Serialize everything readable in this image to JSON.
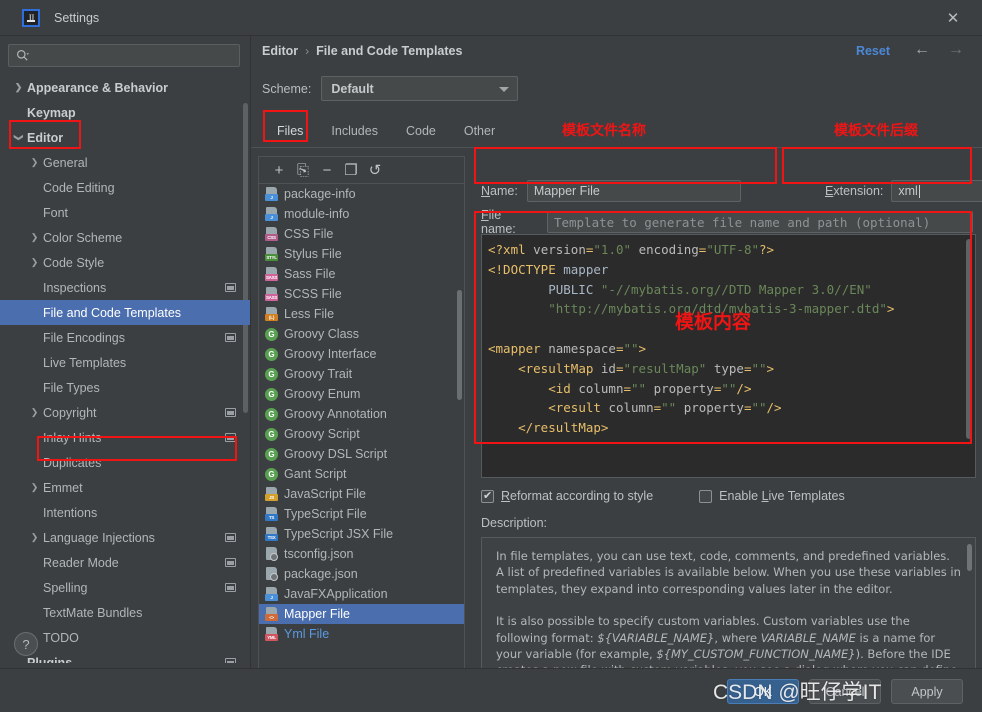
{
  "window": {
    "title": "Settings",
    "logo_icon": "intellij-idea-logo",
    "close_icon": "close-icon"
  },
  "search": {
    "placeholder": "",
    "value": "",
    "icon": "search-icon"
  },
  "sidebar": {
    "items": [
      {
        "label": "Appearance & Behavior",
        "arrow": "right",
        "bold": true,
        "indent": 0,
        "badge": false,
        "selected": false
      },
      {
        "label": "Keymap",
        "arrow": "none",
        "bold": true,
        "indent": 0,
        "badge": false,
        "selected": false
      },
      {
        "label": "Editor",
        "arrow": "down",
        "bold": true,
        "indent": 0,
        "badge": false,
        "selected": false
      },
      {
        "label": "General",
        "arrow": "right",
        "bold": false,
        "indent": 1,
        "badge": false,
        "selected": false
      },
      {
        "label": "Code Editing",
        "arrow": "none",
        "bold": false,
        "indent": 1,
        "badge": false,
        "selected": false
      },
      {
        "label": "Font",
        "arrow": "none",
        "bold": false,
        "indent": 1,
        "badge": false,
        "selected": false
      },
      {
        "label": "Color Scheme",
        "arrow": "right",
        "bold": false,
        "indent": 1,
        "badge": false,
        "selected": false
      },
      {
        "label": "Code Style",
        "arrow": "right",
        "bold": false,
        "indent": 1,
        "badge": false,
        "selected": false
      },
      {
        "label": "Inspections",
        "arrow": "none",
        "bold": false,
        "indent": 1,
        "badge": true,
        "selected": false
      },
      {
        "label": "File and Code Templates",
        "arrow": "none",
        "bold": false,
        "indent": 1,
        "badge": false,
        "selected": true
      },
      {
        "label": "File Encodings",
        "arrow": "none",
        "bold": false,
        "indent": 1,
        "badge": true,
        "selected": false
      },
      {
        "label": "Live Templates",
        "arrow": "none",
        "bold": false,
        "indent": 1,
        "badge": false,
        "selected": false
      },
      {
        "label": "File Types",
        "arrow": "none",
        "bold": false,
        "indent": 1,
        "badge": false,
        "selected": false
      },
      {
        "label": "Copyright",
        "arrow": "right",
        "bold": false,
        "indent": 1,
        "badge": true,
        "selected": false
      },
      {
        "label": "Inlay Hints",
        "arrow": "none",
        "bold": false,
        "indent": 1,
        "badge": true,
        "selected": false
      },
      {
        "label": "Duplicates",
        "arrow": "none",
        "bold": false,
        "indent": 1,
        "badge": false,
        "selected": false
      },
      {
        "label": "Emmet",
        "arrow": "right",
        "bold": false,
        "indent": 1,
        "badge": false,
        "selected": false
      },
      {
        "label": "Intentions",
        "arrow": "none",
        "bold": false,
        "indent": 1,
        "badge": false,
        "selected": false
      },
      {
        "label": "Language Injections",
        "arrow": "right",
        "bold": false,
        "indent": 1,
        "badge": true,
        "selected": false
      },
      {
        "label": "Reader Mode",
        "arrow": "none",
        "bold": false,
        "indent": 1,
        "badge": true,
        "selected": false
      },
      {
        "label": "Spelling",
        "arrow": "none",
        "bold": false,
        "indent": 1,
        "badge": true,
        "selected": false
      },
      {
        "label": "TextMate Bundles",
        "arrow": "none",
        "bold": false,
        "indent": 1,
        "badge": false,
        "selected": false
      },
      {
        "label": "TODO",
        "arrow": "none",
        "bold": false,
        "indent": 1,
        "badge": false,
        "selected": false
      },
      {
        "label": "Plugins",
        "arrow": "none",
        "bold": true,
        "indent": 0,
        "badge": true,
        "selected": false
      }
    ],
    "help_button": "?"
  },
  "header": {
    "breadcrumb_root": "Editor",
    "breadcrumb_sep": "›",
    "breadcrumb_leaf": "File and Code Templates",
    "reset_label": "Reset",
    "back_icon": "arrow-left-icon",
    "forward_icon": "arrow-right-icon"
  },
  "scheme": {
    "label": "Scheme:",
    "value": "Default",
    "caret_icon": "chevron-down-icon"
  },
  "tabs": [
    {
      "label": "Files",
      "active": true
    },
    {
      "label": "Includes",
      "active": false
    },
    {
      "label": "Code",
      "active": false
    },
    {
      "label": "Other",
      "active": false
    }
  ],
  "list_toolbar": [
    {
      "icon": "plus-icon",
      "glyph": "+"
    },
    {
      "icon": "copy-file-icon",
      "glyph": "⎘"
    },
    {
      "icon": "minus-icon",
      "glyph": "−"
    },
    {
      "icon": "duplicate-icon",
      "glyph": "❐"
    },
    {
      "icon": "reset-icon",
      "glyph": "↺"
    }
  ],
  "file_list": [
    {
      "label": "package-info",
      "icon": "java-file-icon",
      "kind": "file",
      "tag": "J",
      "tagcolor": "#4a90d9",
      "selected": false,
      "custom": false
    },
    {
      "label": "module-info",
      "icon": "java-file-icon",
      "kind": "file",
      "tag": "J",
      "tagcolor": "#4a90d9",
      "selected": false,
      "custom": false
    },
    {
      "label": "CSS File",
      "icon": "css-file-icon",
      "kind": "file",
      "tag": "CSS",
      "tagcolor": "#b05b8a",
      "selected": false,
      "custom": false
    },
    {
      "label": "Stylus File",
      "icon": "stylus-file-icon",
      "kind": "file",
      "tag": "STYL",
      "tagcolor": "#4b8f3d",
      "selected": false,
      "custom": false
    },
    {
      "label": "Sass File",
      "icon": "sass-file-icon",
      "kind": "file",
      "tag": "SASS",
      "tagcolor": "#cf649a",
      "selected": false,
      "custom": false
    },
    {
      "label": "SCSS File",
      "icon": "scss-file-icon",
      "kind": "file",
      "tag": "SASS",
      "tagcolor": "#cf649a",
      "selected": false,
      "custom": false
    },
    {
      "label": "Less File",
      "icon": "less-file-icon",
      "kind": "file",
      "tag": "{L}",
      "tagcolor": "#d08020",
      "selected": false,
      "custom": false
    },
    {
      "label": "Groovy Class",
      "icon": "groovy-class-icon",
      "kind": "groovy",
      "tag": "G",
      "tagcolor": "#5aa052",
      "selected": false,
      "custom": false
    },
    {
      "label": "Groovy Interface",
      "icon": "groovy-interface-icon",
      "kind": "groovy",
      "tag": "G",
      "tagcolor": "#5aa052",
      "selected": false,
      "custom": false
    },
    {
      "label": "Groovy Trait",
      "icon": "groovy-trait-icon",
      "kind": "groovy",
      "tag": "G",
      "tagcolor": "#5aa052",
      "selected": false,
      "custom": false
    },
    {
      "label": "Groovy Enum",
      "icon": "groovy-enum-icon",
      "kind": "groovy",
      "tag": "G",
      "tagcolor": "#5aa052",
      "selected": false,
      "custom": false
    },
    {
      "label": "Groovy Annotation",
      "icon": "groovy-annotation-icon",
      "kind": "groovy",
      "tag": "G",
      "tagcolor": "#5aa052",
      "selected": false,
      "custom": false
    },
    {
      "label": "Groovy Script",
      "icon": "groovy-script-icon",
      "kind": "groovy",
      "tag": "G",
      "tagcolor": "#5aa052",
      "selected": false,
      "custom": false
    },
    {
      "label": "Groovy DSL Script",
      "icon": "groovy-dsl-icon",
      "kind": "groovy",
      "tag": "G",
      "tagcolor": "#5aa052",
      "selected": false,
      "custom": false
    },
    {
      "label": "Gant Script",
      "icon": "gant-script-icon",
      "kind": "groovy",
      "tag": "G",
      "tagcolor": "#5aa052",
      "selected": false,
      "custom": false
    },
    {
      "label": "JavaScript File",
      "icon": "javascript-file-icon",
      "kind": "file",
      "tag": "JS",
      "tagcolor": "#d3a02c",
      "selected": false,
      "custom": false
    },
    {
      "label": "TypeScript File",
      "icon": "typescript-file-icon",
      "kind": "file",
      "tag": "TS",
      "tagcolor": "#3178c6",
      "selected": false,
      "custom": false
    },
    {
      "label": "TypeScript JSX File",
      "icon": "typescript-jsx-icon",
      "kind": "file",
      "tag": "TSX",
      "tagcolor": "#3178c6",
      "selected": false,
      "custom": false
    },
    {
      "label": "tsconfig.json",
      "icon": "json-file-icon",
      "kind": "json",
      "tag": "",
      "tagcolor": "#8a8f93",
      "selected": false,
      "custom": false
    },
    {
      "label": "package.json",
      "icon": "json-file-icon",
      "kind": "json",
      "tag": "",
      "tagcolor": "#8a8f93",
      "selected": false,
      "custom": false
    },
    {
      "label": "JavaFXApplication",
      "icon": "java-file-icon",
      "kind": "file",
      "tag": "J",
      "tagcolor": "#4a90d9",
      "selected": false,
      "custom": false
    },
    {
      "label": "Mapper File",
      "icon": "xml-file-icon",
      "kind": "file",
      "tag": "<>",
      "tagcolor": "#cf6a3a",
      "selected": true,
      "custom": true
    },
    {
      "label": "Yml File",
      "icon": "yml-file-icon",
      "kind": "file",
      "tag": "YML",
      "tagcolor": "#cf5560",
      "selected": false,
      "custom": true
    }
  ],
  "form": {
    "name_label": "Name:",
    "name_label_mnemonic": "N",
    "name_value": "Mapper File",
    "extension_label": "Extension:",
    "extension_label_mnemonic": "E",
    "extension_value": "xml",
    "filename_label": "File name:",
    "filename_label_mnemonic": "F",
    "filename_value": "",
    "filename_placeholder": "Template to generate file name and path (optional)"
  },
  "code": {
    "lines": [
      [
        {
          "t": "tag",
          "s": "<?xml"
        },
        {
          "t": "plain",
          "s": " "
        },
        {
          "t": "attr",
          "s": "version"
        },
        {
          "t": "tag",
          "s": "="
        },
        {
          "t": "str",
          "s": "\"1.0\""
        },
        {
          "t": "plain",
          "s": " "
        },
        {
          "t": "attr",
          "s": "encoding"
        },
        {
          "t": "tag",
          "s": "="
        },
        {
          "t": "str",
          "s": "\"UTF-8\""
        },
        {
          "t": "tag",
          "s": "?>"
        }
      ],
      [
        {
          "t": "tag",
          "s": "<!DOCTYPE"
        },
        {
          "t": "plain",
          "s": " mapper"
        }
      ],
      [
        {
          "t": "plain",
          "s": "        PUBLIC "
        },
        {
          "t": "str",
          "s": "\"-//mybatis.org//DTD Mapper 3.0//EN\""
        }
      ],
      [
        {
          "t": "plain",
          "s": "        "
        },
        {
          "t": "str",
          "s": "\"http://mybatis.org/dtd/mybatis-3-mapper.dtd\""
        },
        {
          "t": "tag",
          "s": ">"
        }
      ],
      [
        {
          "t": "plain",
          "s": ""
        }
      ],
      [
        {
          "t": "tag",
          "s": "<mapper"
        },
        {
          "t": "plain",
          "s": " "
        },
        {
          "t": "attr",
          "s": "namespace"
        },
        {
          "t": "tag",
          "s": "="
        },
        {
          "t": "str",
          "s": "\"\""
        },
        {
          "t": "tag",
          "s": ">"
        }
      ],
      [
        {
          "t": "plain",
          "s": "    "
        },
        {
          "t": "tag",
          "s": "<resultMap"
        },
        {
          "t": "plain",
          "s": " "
        },
        {
          "t": "attr",
          "s": "id"
        },
        {
          "t": "tag",
          "s": "="
        },
        {
          "t": "str",
          "s": "\"resultMap\""
        },
        {
          "t": "plain",
          "s": " "
        },
        {
          "t": "attr",
          "s": "type"
        },
        {
          "t": "tag",
          "s": "="
        },
        {
          "t": "str",
          "s": "\"\""
        },
        {
          "t": "tag",
          "s": ">"
        }
      ],
      [
        {
          "t": "plain",
          "s": "        "
        },
        {
          "t": "tag",
          "s": "<id"
        },
        {
          "t": "plain",
          "s": " "
        },
        {
          "t": "attr",
          "s": "column"
        },
        {
          "t": "tag",
          "s": "="
        },
        {
          "t": "str",
          "s": "\"\""
        },
        {
          "t": "plain",
          "s": " "
        },
        {
          "t": "attr",
          "s": "property"
        },
        {
          "t": "tag",
          "s": "="
        },
        {
          "t": "str",
          "s": "\"\""
        },
        {
          "t": "tag",
          "s": "/>"
        }
      ],
      [
        {
          "t": "plain",
          "s": "        "
        },
        {
          "t": "tag",
          "s": "<result"
        },
        {
          "t": "plain",
          "s": " "
        },
        {
          "t": "attr",
          "s": "column"
        },
        {
          "t": "tag",
          "s": "="
        },
        {
          "t": "str",
          "s": "\"\""
        },
        {
          "t": "plain",
          "s": " "
        },
        {
          "t": "attr",
          "s": "property"
        },
        {
          "t": "tag",
          "s": "="
        },
        {
          "t": "str",
          "s": "\"\""
        },
        {
          "t": "tag",
          "s": "/>"
        }
      ],
      [
        {
          "t": "plain",
          "s": "    "
        },
        {
          "t": "tag",
          "s": "</resultMap>"
        }
      ]
    ]
  },
  "options": {
    "reformat_label": "Reformat according to style",
    "reformat_mnemonic": "R",
    "reformat_checked": true,
    "live_templates_label": "Enable Live Templates",
    "live_templates_mnemonic": "L",
    "live_templates_checked": false
  },
  "description": {
    "label": "Description:",
    "paragraph1": "In file templates, you can use text, code, comments, and predefined variables. A list of predefined variables is available below. When you use these variables in templates, they expand into corresponding values later in the editor.",
    "paragraph2_a": "It is also possible to specify custom variables. Custom variables use the following format: ",
    "paragraph2_var1": "${VARIABLE_NAME}",
    "paragraph2_b": ", where ",
    "paragraph2_var2": "VARIABLE_NAME",
    "paragraph2_c": " is a name for your variable (for example, ",
    "paragraph2_var3": "${MY_CUSTOM_FUNCTION_NAME}",
    "paragraph2_d": "). Before the IDE creates a new file with custom variables, you see a dialog where you can define values for custom variables in the template."
  },
  "footer": {
    "ok_label": "OK",
    "cancel_label": "Cancel",
    "apply_label": "Apply"
  },
  "annotations": {
    "name_caption": "模板文件名称",
    "extension_caption": "模板文件后缀",
    "content_caption": "模板内容",
    "color": "#f01414"
  },
  "watermark": {
    "text": "CSDN @旺仔学IT"
  }
}
